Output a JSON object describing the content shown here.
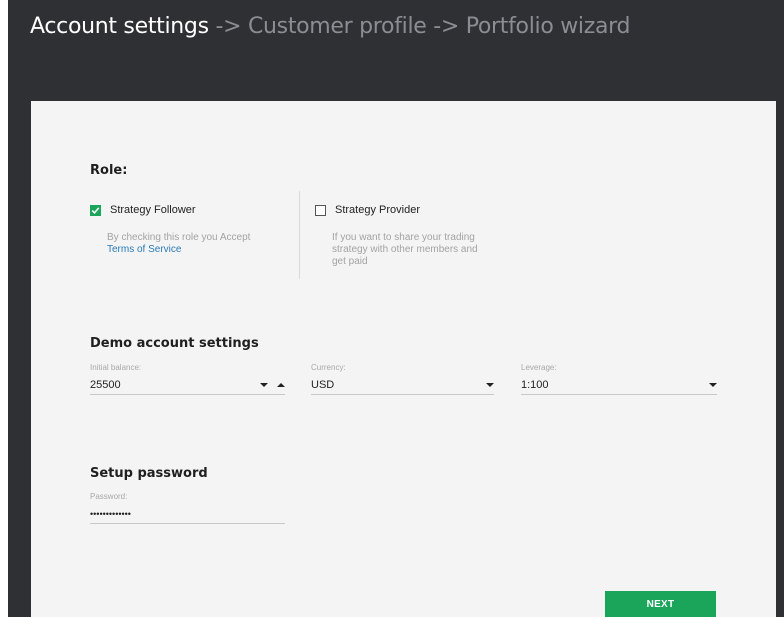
{
  "breadcrumb": {
    "active": "Account settings",
    "separator1": "->",
    "step2": "Customer profile",
    "separator2": "->",
    "step3": "Portfolio wizard"
  },
  "role": {
    "title": "Role:",
    "follower": {
      "label": "Strategy Follower",
      "checked": true,
      "desc": "By checking this role you Accept",
      "link": "Terms of Service"
    },
    "provider": {
      "label": "Strategy Provider",
      "checked": false,
      "desc_line1": "If you want to share your trading",
      "desc_line2": "strategy with other members and",
      "desc_line3": "get paid"
    }
  },
  "demo": {
    "title": "Demo account settings",
    "balance": {
      "label": "Initial balance:",
      "value": "25500"
    },
    "currency": {
      "label": "Currency:",
      "value": "USD"
    },
    "leverage": {
      "label": "Leverage:",
      "value": "1:100"
    }
  },
  "password": {
    "title": "Setup password",
    "label": "Password:",
    "value": "•••••••••••••"
  },
  "next_label": "NEXT",
  "colors": {
    "accent": "#1aa55a",
    "header_bg": "#2e3034",
    "card_bg": "#f4f4f4",
    "link": "#2a7ab8"
  },
  "icons": {
    "check": "checkmark-icon",
    "dropdown": "chevron-down-icon",
    "increment": "chevron-up-icon"
  }
}
